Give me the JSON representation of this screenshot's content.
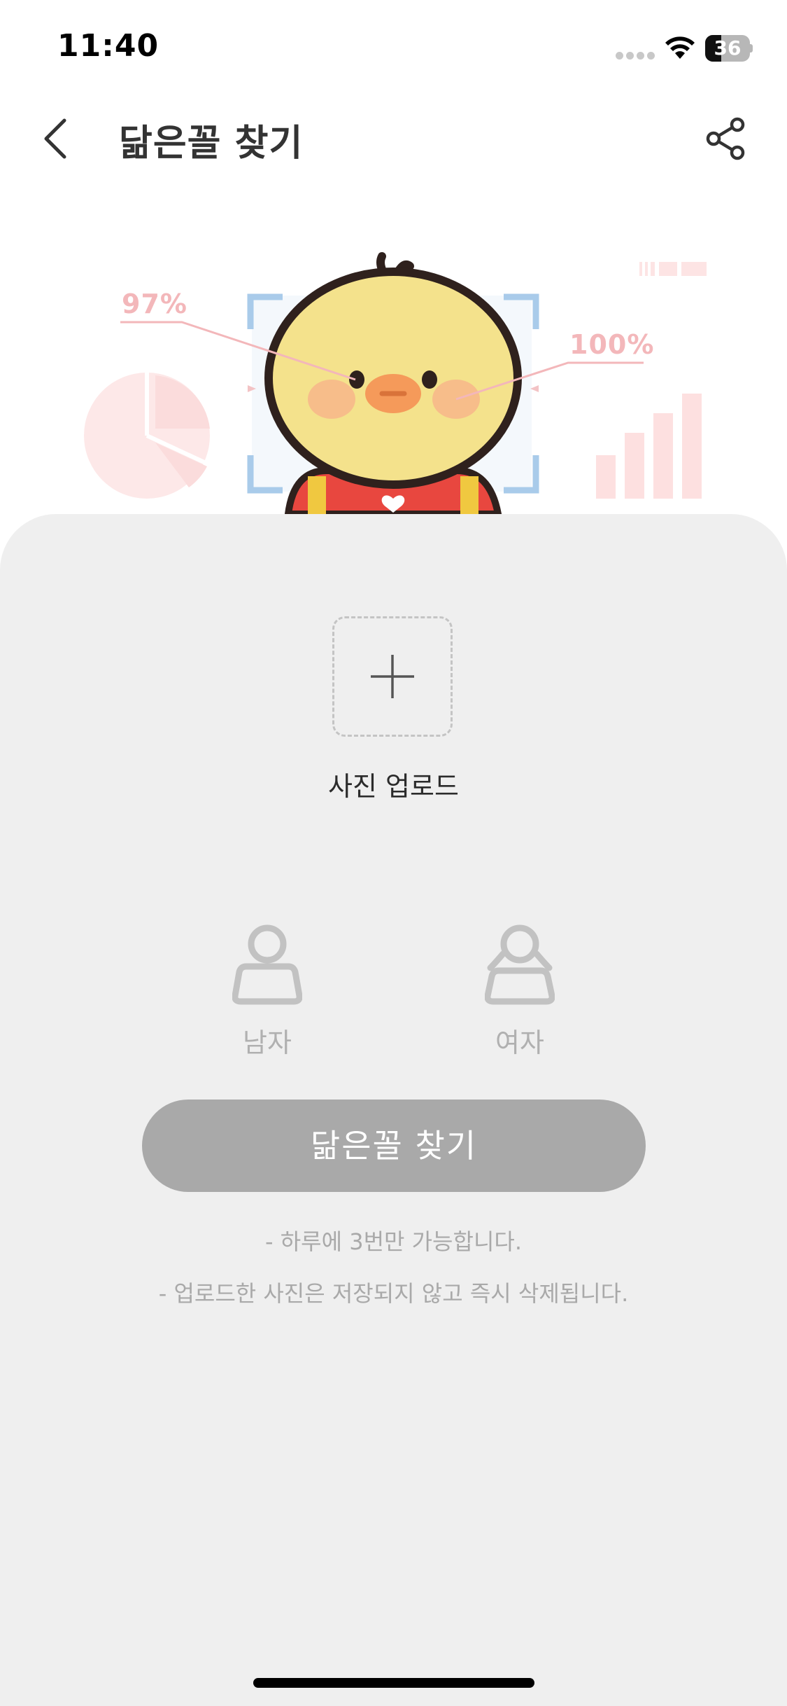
{
  "status_bar": {
    "time": "11:40",
    "battery_level": "36",
    "battery_fraction": 0.36
  },
  "nav": {
    "title": "닮은꼴 찾기",
    "back_icon": "chevron-left-icon",
    "share_icon": "share-icon"
  },
  "hero": {
    "left_percent": "97%",
    "right_percent": "100%",
    "accent_pink": "#f3b7ba",
    "frame_blue": "#a9cbea"
  },
  "upload": {
    "icon": "plus-icon",
    "label": "사진 업로드"
  },
  "gender": {
    "male_label": "남자",
    "female_label": "여자",
    "icon_color": "#c2c2c2"
  },
  "find_button": {
    "label": "닮은꼴 찾기",
    "color": "#a9a9a9"
  },
  "notices": [
    "- 하루에 3번만 가능합니다.",
    "- 업로드한 사진은 저장되지 않고 즉시 삭제됩니다."
  ]
}
